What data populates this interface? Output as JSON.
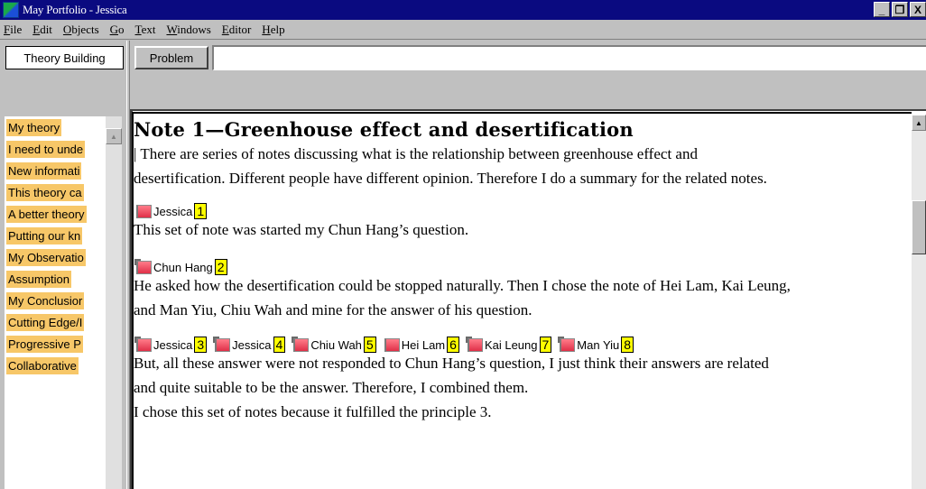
{
  "window": {
    "title": "May Portfolio - Jessica",
    "controls": {
      "minimize": "_",
      "restore": "Ĺ",
      "close": "X"
    }
  },
  "menu": {
    "items": [
      {
        "label": "File",
        "accel": "F",
        "rest": "ile"
      },
      {
        "label": "Edit",
        "accel": "E",
        "rest": "dit"
      },
      {
        "label": "Objects",
        "accel": "O",
        "rest": "bjects"
      },
      {
        "label": "Go",
        "accel": "G",
        "rest": "o"
      },
      {
        "label": "Text",
        "accel": "T",
        "rest": "ext"
      },
      {
        "label": "Windows",
        "accel": "W",
        "rest": "indows"
      },
      {
        "label": "Editor",
        "accel": "E",
        "rest": "ditor"
      },
      {
        "label": "Help",
        "accel": "H",
        "rest": "elp"
      }
    ]
  },
  "tabs": {
    "left_tab": "Theory Building",
    "problem_button": "Problem",
    "problem_value": ""
  },
  "sidebar": {
    "items": [
      "My theory",
      "I need to unde",
      "New informati",
      "This theory ca",
      "A better theory",
      "Putting our kn",
      "My Observatio",
      "Assumption",
      "My Conclusior",
      "Cutting Edge/I",
      "Progressive P",
      "Collaborative"
    ],
    "highlight_color": "#f7c768"
  },
  "note": {
    "title": "Note 1—Greenhouse effect and desertification",
    "intro_line1": "   |  There are series of notes discussing what is the relationship between greenhouse effect and",
    "intro_line2": "desertification. Different people have different opinion. Therefore I do a summary for the related notes.",
    "ref1": {
      "name": "Jessica",
      "num": "1"
    },
    "line_after_ref1": "   This set of note was started my Chun Hang’s question.",
    "ref2": {
      "name": "Chun Hang",
      "num": "2"
    },
    "para2_line1": " He asked how the desertification could be stopped naturally. Then I chose the note of Hei Lam, Kai Leung,",
    "para2_line2": "and Man Yiu, Chiu Wah and mine for the answer of his question.",
    "refs_row": [
      {
        "name": "Jessica",
        "num": "3"
      },
      {
        "name": "Jessica",
        "num": "4"
      },
      {
        "name": "Chiu Wah",
        "num": "5"
      },
      {
        "name": "Hei Lam",
        "num": "6"
      },
      {
        "name": "Kai Leung",
        "num": "7"
      },
      {
        "name": "Man Yiu",
        "num": "8"
      }
    ],
    "para3_line1": "But, all these answer were not responded to Chun Hang’s question, I just think their answers are related",
    "para3_line2": "and quite suitable to be the answer. Therefore, I combined them.",
    "para3_line3": "   I chose this set of notes because it fulfilled the principle 3."
  },
  "colors": {
    "title_bar": "#0a0a80",
    "ref_number_bg": "#ffff00",
    "note_icon": "#e03048"
  }
}
